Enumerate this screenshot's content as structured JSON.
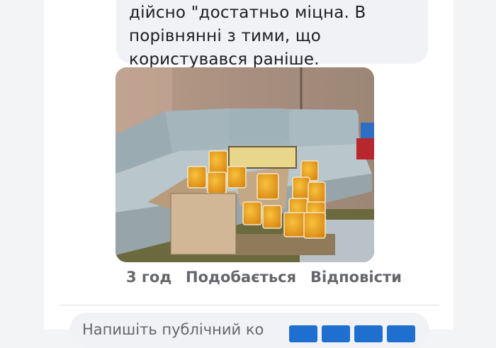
{
  "comment": {
    "lines": [
      "дійсно \"достатньо міцна. В",
      "порівнянні з тими, що",
      "користувався раніше."
    ],
    "image_icon": "photo-of-honey-jars"
  },
  "actions": {
    "time": "3 год",
    "like": "Подобається",
    "reply": "Відповісти"
  },
  "composer": {
    "placeholder": "Напишіть публічний ко",
    "icons": [
      "emoji-icon",
      "camera-icon",
      "gif-icon",
      "sticker-icon"
    ]
  },
  "colors": {
    "accent": "#1f6fd1",
    "bubble": "#f0f2f5",
    "secondary_text": "#65676b"
  }
}
